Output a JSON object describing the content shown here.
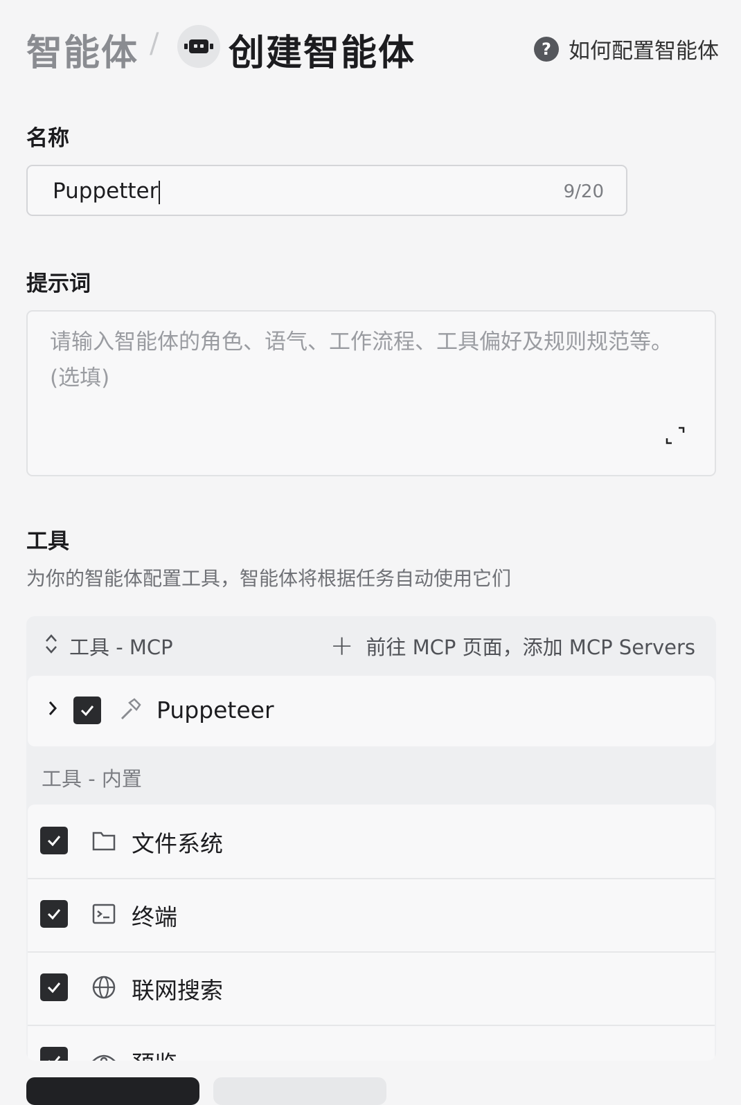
{
  "header": {
    "breadcrumb_root": "智能体",
    "breadcrumb_sep": "/",
    "title": "创建智能体",
    "help_label": "如何配置智能体"
  },
  "name_field": {
    "label": "名称",
    "value": "Puppetter",
    "counter": "9/20"
  },
  "prompt_field": {
    "label": "提示词",
    "placeholder": "请输入智能体的角色、语气、工作流程、工具偏好及规则规范等。(选填)"
  },
  "tools": {
    "label": "工具",
    "description": "为你的智能体配置工具，智能体将根据任务自动使用它们",
    "mcp_section": {
      "title": "工具 - MCP",
      "add_label": "前往 MCP 页面，添加 MCP Servers",
      "items": [
        {
          "name": "Puppeteer",
          "checked": true,
          "icon": "hammer-icon"
        }
      ]
    },
    "builtin_section": {
      "title": "工具 - 内置",
      "items": [
        {
          "name": "文件系统",
          "checked": true,
          "icon": "folder-icon"
        },
        {
          "name": "终端",
          "checked": true,
          "icon": "terminal-icon"
        },
        {
          "name": "联网搜索",
          "checked": true,
          "icon": "globe-icon"
        },
        {
          "name": "预览",
          "checked": true,
          "icon": "preview-icon"
        }
      ]
    }
  },
  "colors": {
    "background": "#f5f5f6",
    "checkbox": "#2a2b2e",
    "primary_button": "#202124"
  }
}
